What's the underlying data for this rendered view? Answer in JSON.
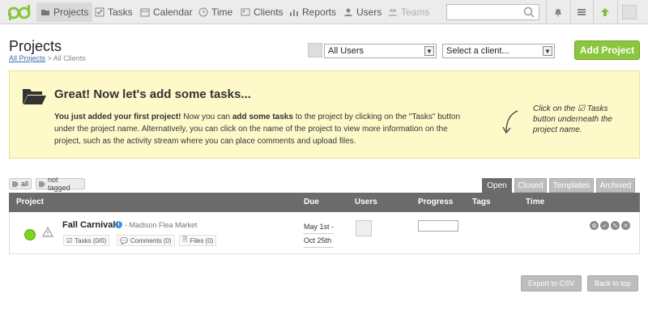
{
  "nav": {
    "items": [
      {
        "label": "Projects",
        "icon": "folder-icon",
        "active": true
      },
      {
        "label": "Tasks",
        "icon": "checkbox-icon"
      },
      {
        "label": "Calendar",
        "icon": "calendar-icon"
      },
      {
        "label": "Time",
        "icon": "clock-icon"
      },
      {
        "label": "Clients",
        "icon": "clients-icon"
      },
      {
        "label": "Reports",
        "icon": "chart-icon"
      },
      {
        "label": "Users",
        "icon": "user-icon"
      },
      {
        "label": "Teams",
        "icon": "teams-icon",
        "disabled": true
      }
    ],
    "search_placeholder": ""
  },
  "header": {
    "title": "Projects",
    "breadcrumb_link": "All Projects",
    "breadcrumb_rest": " > All Clients",
    "users_select": "All Users",
    "client_select": "Select a client...",
    "add_project": "Add Project"
  },
  "alert": {
    "title": "Great! Now let's add some tasks...",
    "body_b1": "You just added your first project!",
    "body_t1": " Now you can ",
    "body_b2": "add some tasks",
    "body_t2": " to the project by clicking on the \"Tasks\" button under the project name. Alternatively, you can click on the name of the project to view more information on the project, such as the activity stream where you can place comments and upload files.",
    "hint_a": "Click on the ",
    "hint_b": " Tasks button underneath the project name."
  },
  "tags": {
    "all": "all",
    "not_tagged": "not tagged"
  },
  "tabs": [
    "Open",
    "Closed",
    "Templates",
    "Archived"
  ],
  "table": {
    "headers": {
      "project": "Project",
      "due": "Due",
      "users": "Users",
      "progress": "Progress",
      "tags": "Tags",
      "time": "Time"
    },
    "rows": [
      {
        "name": "Fall Carnival",
        "client": "- Madison Flea Market",
        "tasks": "Tasks (0/0)",
        "comments": "Comments (0)",
        "files": "Files (0)",
        "due_start": "May 1st -",
        "due_end": "Oct 25th",
        "progress": 0
      }
    ]
  },
  "footer": {
    "export": "Export to CSV",
    "back": "Back to top"
  },
  "colors": {
    "accent": "#8cc63f",
    "header_bar": "#6b6b6b",
    "alert_bg": "#fdf9c9"
  }
}
